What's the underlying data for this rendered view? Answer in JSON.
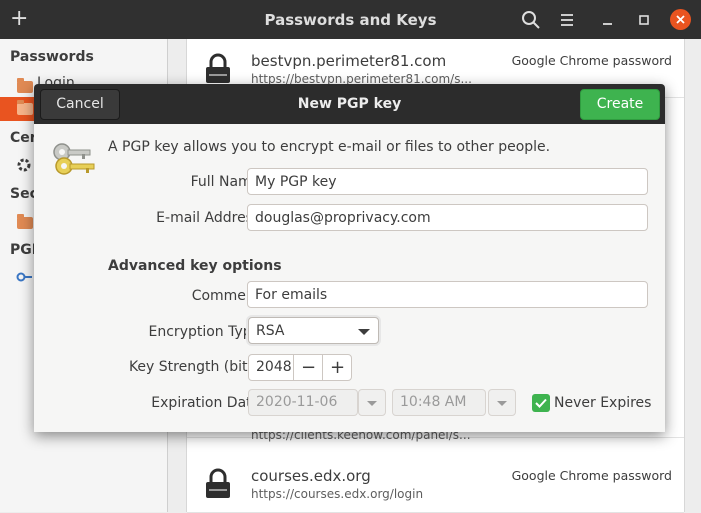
{
  "window": {
    "title": "Passwords and Keys"
  },
  "sidebar": {
    "headers": {
      "passwords": "Passwords",
      "certificates": "Cer",
      "secure": "Sec",
      "pgp": "PGP"
    },
    "items": [
      {
        "label": "Login"
      },
      {
        "label": ""
      }
    ]
  },
  "list": {
    "rows": [
      {
        "host": "bestvpn.perimeter81.com",
        "url": "https://bestvpn.perimeter81.com/s...",
        "kind": "Google Chrome password"
      },
      {
        "host": "",
        "url": "https://clients.keenow.com/panel/s...",
        "kind": ""
      },
      {
        "host": "courses.edx.org",
        "url": "https://courses.edx.org/login",
        "kind": "Google Chrome password"
      }
    ]
  },
  "dialog": {
    "title": "New PGP key",
    "cancel_label": "Cancel",
    "create_label": "Create",
    "intro": "A PGP key allows you to encrypt e-mail or files to other people.",
    "full_name_label": "Full Name:",
    "full_name_value": "My  PGP key",
    "email_label": "E-mail Address:",
    "email_value": "douglas@proprivacy.com",
    "advanced_heading": "Advanced key options",
    "comment_label": "Comment:",
    "comment_value": "For emails",
    "encryption_label": "Encryption Type:",
    "encryption_value": "RSA",
    "strength_label": "Key Strength (bits):",
    "strength_value": "2048",
    "expiration_label": "Expiration Date:",
    "expiration_date": "2020-11-06",
    "expiration_time": "10:48 AM",
    "never_expires_label": "Never Expires",
    "never_expires_checked": true
  },
  "colors": {
    "accent": "#e95420",
    "create": "#3eb34f",
    "titlebar": "#303030"
  }
}
